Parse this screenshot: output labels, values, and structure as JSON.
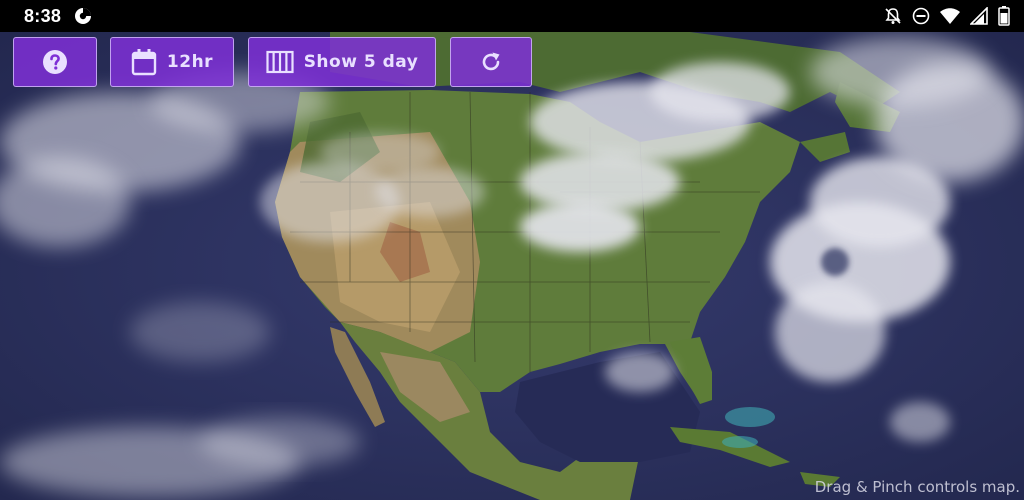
{
  "status_bar": {
    "time": "8:38",
    "left_icon": "data-saver-icon",
    "right_icons": [
      "notifications-off-icon",
      "do-not-disturb-icon",
      "wifi-icon",
      "signal-icon",
      "battery-icon"
    ]
  },
  "toolbar": {
    "help_icon": "help-icon",
    "range_label": "12hr",
    "range_icon": "calendar-icon",
    "forecast_label": "Show 5 day",
    "forecast_icon": "columns-icon",
    "refresh_icon": "refresh-icon"
  },
  "map": {
    "description_hint": "Drag & Pinch controls map."
  },
  "colors": {
    "button_fill": "#7e30d6",
    "button_border": "#dcc8ff",
    "ocean": "#2f3566",
    "land": "#5a7a3a"
  }
}
